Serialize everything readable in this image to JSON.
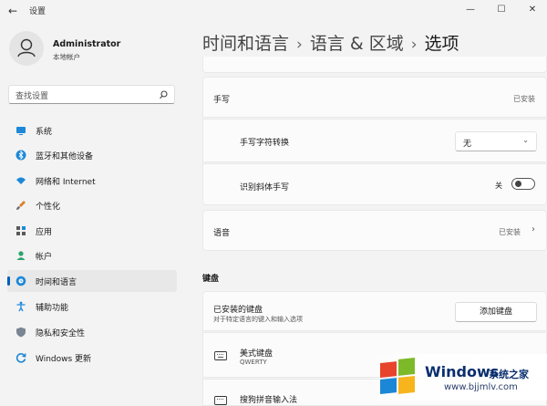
{
  "window": {
    "title": "设置",
    "controls": [
      "minimize-icon",
      "maximize-icon",
      "close-icon"
    ]
  },
  "user": {
    "name": "Administrator",
    "subtitle": "本地帐户"
  },
  "search": {
    "placeholder": "查找设置"
  },
  "sidebar": {
    "items": [
      {
        "label": "系统",
        "icon": "display-icon"
      },
      {
        "label": "蓝牙和其他设备",
        "icon": "bluetooth-icon"
      },
      {
        "label": "网络和 Internet",
        "icon": "wifi-icon"
      },
      {
        "label": "个性化",
        "icon": "brush-icon"
      },
      {
        "label": "应用",
        "icon": "apps-icon"
      },
      {
        "label": "帐户",
        "icon": "person-icon"
      },
      {
        "label": "时间和语言",
        "icon": "globe-clock-icon",
        "selected": true
      },
      {
        "label": "辅助功能",
        "icon": "accessibility-icon"
      },
      {
        "label": "隐私和安全性",
        "icon": "shield-icon"
      },
      {
        "label": "Windows 更新",
        "icon": "update-icon"
      }
    ]
  },
  "breadcrumb": {
    "parts": [
      "时间和语言",
      "语言 & 区域",
      "选项"
    ],
    "separator": "›"
  },
  "handwriting": {
    "label": "手写",
    "status": "已安装",
    "conversion_label": "手写字符转换",
    "conversion_value": "无",
    "italic_label": "识别斜体手写",
    "italic_state": "关",
    "italic_on": false
  },
  "speech": {
    "label": "语音",
    "status": "已安装"
  },
  "keyboard": {
    "section_title": "键盘",
    "installed_label": "已安装的键盘",
    "installed_desc": "对于特定语言的键入和输入选项",
    "add_button": "添加键盘",
    "layouts": [
      {
        "name": "美式键盘",
        "sub": "QWERTY"
      },
      {
        "name": "搜狗拼音输入法",
        "sub": ""
      }
    ]
  },
  "watermark": {
    "brand": "Windows",
    "tagline": "系统之家",
    "url": "www.bjjmlv.com"
  },
  "colors": {
    "accent": "#005fb8",
    "background": "#f3f3f3",
    "card": "#fbfbfb"
  }
}
